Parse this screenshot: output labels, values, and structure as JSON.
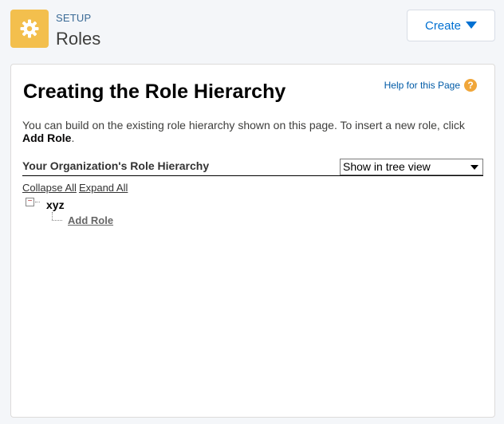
{
  "header": {
    "section_label": "SETUP",
    "title": "Roles",
    "create_label": "Create",
    "setup_icon": "gear-icon"
  },
  "card": {
    "title": "Creating the Role Hierarchy",
    "help_label": "Help for this Page",
    "help_icon_glyph": "?",
    "intro_text": "You can build on the existing role hierarchy shown on this page. To insert a new role, click ",
    "intro_bold": "Add Role",
    "intro_end": "."
  },
  "hierarchy": {
    "section_title": "Your Organization's Role Hierarchy",
    "view_selected": "Show in tree view",
    "collapse_all": "Collapse All",
    "expand_all": "Expand All",
    "toggle_glyph": "−",
    "root_node": "xyz",
    "add_role": "Add Role"
  },
  "colors": {
    "setup_icon_bg": "#f3bf4d",
    "link_blue": "#0070d2",
    "help_icon": "#f0a63a"
  }
}
